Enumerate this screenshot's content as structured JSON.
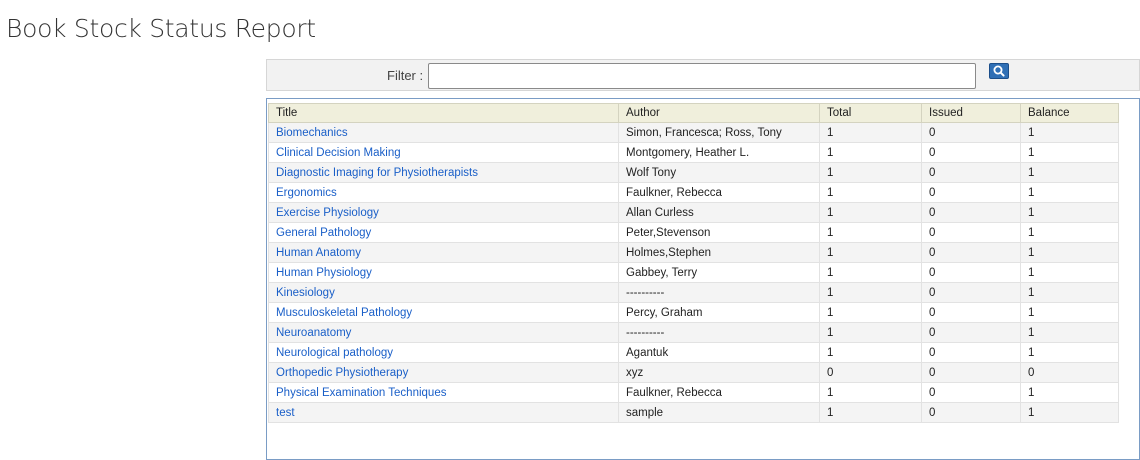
{
  "page": {
    "title": "Book Stock Status Report"
  },
  "filter": {
    "label": "Filter :",
    "value": "",
    "placeholder": ""
  },
  "table": {
    "columns": [
      "Title",
      "Author",
      "Total",
      "Issued",
      "Balance"
    ],
    "rows": [
      [
        "Biomechanics",
        "Simon, Francesca; Ross, Tony",
        "1",
        "0",
        "1"
      ],
      [
        "Clinical Decision Making",
        "Montgomery, Heather L.",
        "1",
        "0",
        "1"
      ],
      [
        "Diagnostic Imaging for Physiotherapists",
        "Wolf Tony",
        "1",
        "0",
        "1"
      ],
      [
        "Ergonomics",
        "Faulkner, Rebecca",
        "1",
        "0",
        "1"
      ],
      [
        "Exercise Physiology",
        "Allan Curless",
        "1",
        "0",
        "1"
      ],
      [
        "General Pathology",
        "Peter,Stevenson",
        "1",
        "0",
        "1"
      ],
      [
        "Human Anatomy",
        "Holmes,Stephen",
        "1",
        "0",
        "1"
      ],
      [
        "Human Physiology",
        "Gabbey, Terry",
        "1",
        "0",
        "1"
      ],
      [
        "Kinesiology",
        "----------",
        "1",
        "0",
        "1"
      ],
      [
        "Musculoskeletal Pathology",
        "Percy, Graham",
        "1",
        "0",
        "1"
      ],
      [
        "Neuroanatomy",
        "----------",
        "1",
        "0",
        "1"
      ],
      [
        "Neurological pathology",
        "Agantuk",
        "1",
        "0",
        "1"
      ],
      [
        "Orthopedic Physiotherapy",
        "xyz",
        "0",
        "0",
        "0"
      ],
      [
        "Physical Examination Techniques",
        "Faulkner, Rebecca",
        "1",
        "0",
        "1"
      ],
      [
        "test",
        "sample",
        "1",
        "0",
        "1"
      ]
    ]
  },
  "colors": {
    "link": "#1a5fc8",
    "header_bg": "#f0efdc",
    "panel_border": "#7a9cc5",
    "search_button": "#2f6fb5"
  },
  "icons": {
    "search": "search-icon"
  }
}
